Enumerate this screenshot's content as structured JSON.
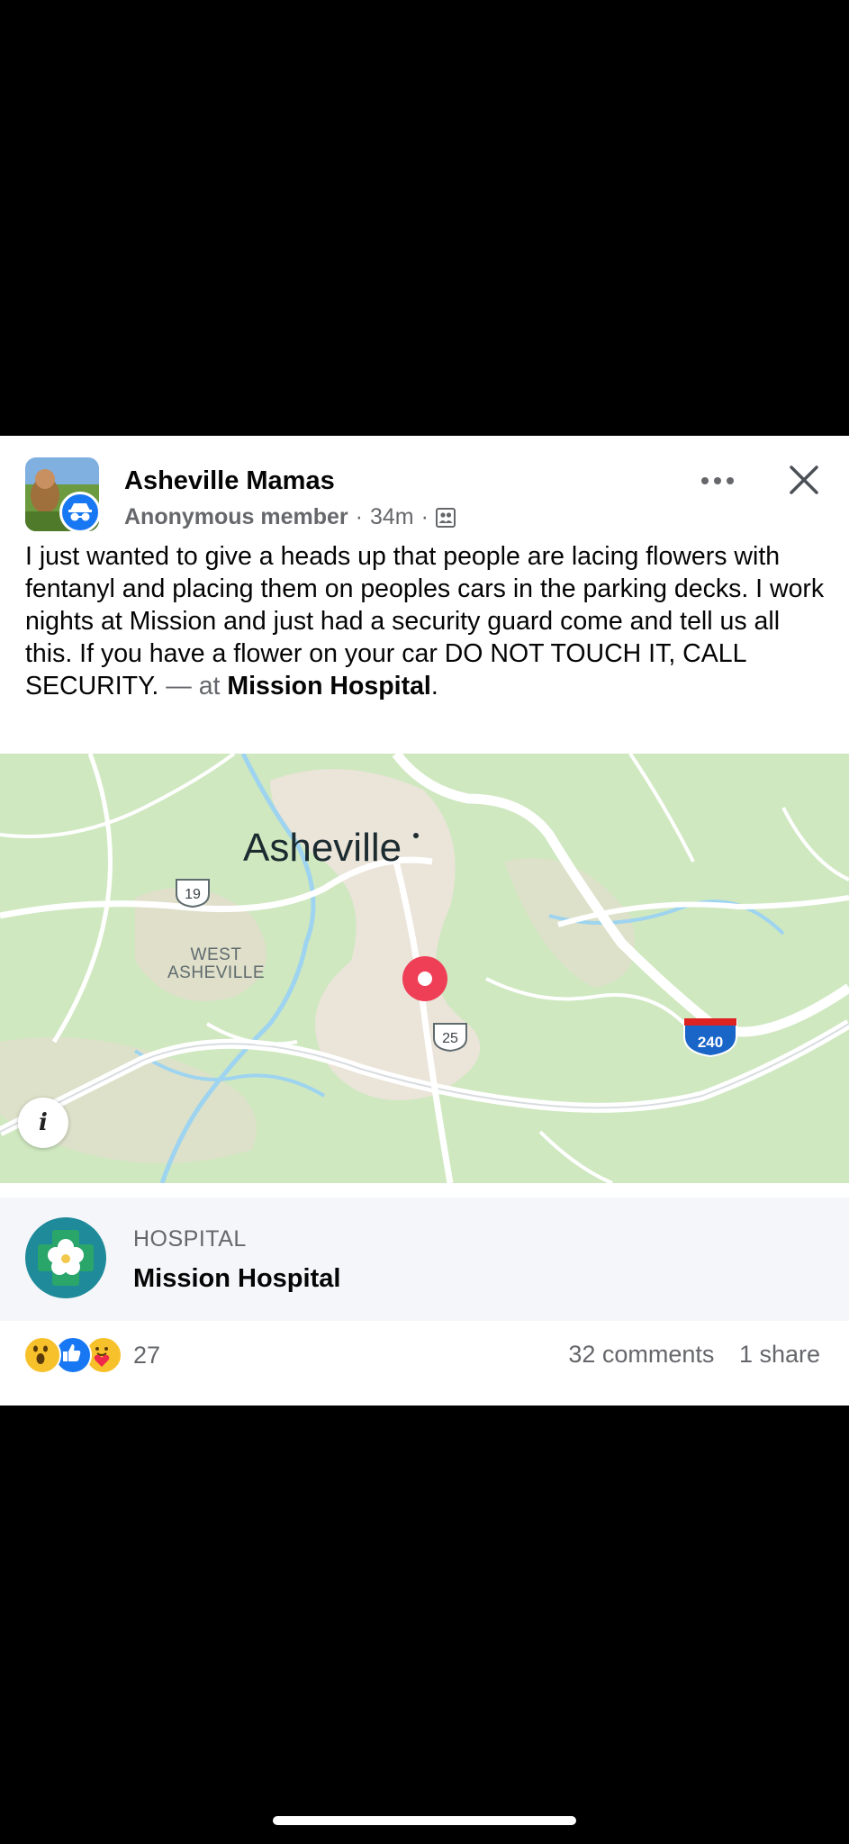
{
  "post": {
    "group_name": "Asheville Mamas",
    "author": "Anonymous member",
    "separator": "·",
    "time": "34m",
    "privacy_icon": "group-members-icon",
    "more_icon": "more-options-icon",
    "close_icon": "close-icon",
    "body": "I just wanted to give a heads up that people are lacing flowers with fentanyl and placing them on peoples cars in the parking decks. I work nights at Mission and just had a security guard come and tell us all this. If you have a flower on your car DO NOT TOUCH IT, CALL SECURITY.",
    "at_prefix": "— at",
    "place": "Mission Hospital",
    "place_suffix": "."
  },
  "map": {
    "city_label": "Asheville",
    "area_label_line1": "WEST",
    "area_label_line2": "ASHEVILLE",
    "route_19": "19",
    "route_25": "25",
    "route_240": "240",
    "info_label": "i"
  },
  "place_card": {
    "category": "HOSPITAL",
    "name": "Mission Hospital"
  },
  "footer": {
    "reaction_icons": [
      "wow-icon",
      "like-icon",
      "care-icon"
    ],
    "reaction_count": "27",
    "comments": "32 comments",
    "shares": "1 share"
  },
  "colors": {
    "map_bg": "#cfe8c0",
    "map_urban": "#ece3db",
    "road": "#ffffff",
    "water": "#9ed4f0",
    "pin": "#ef3f57",
    "interstate": "#1a66c8",
    "text_secondary": "#65676b"
  }
}
